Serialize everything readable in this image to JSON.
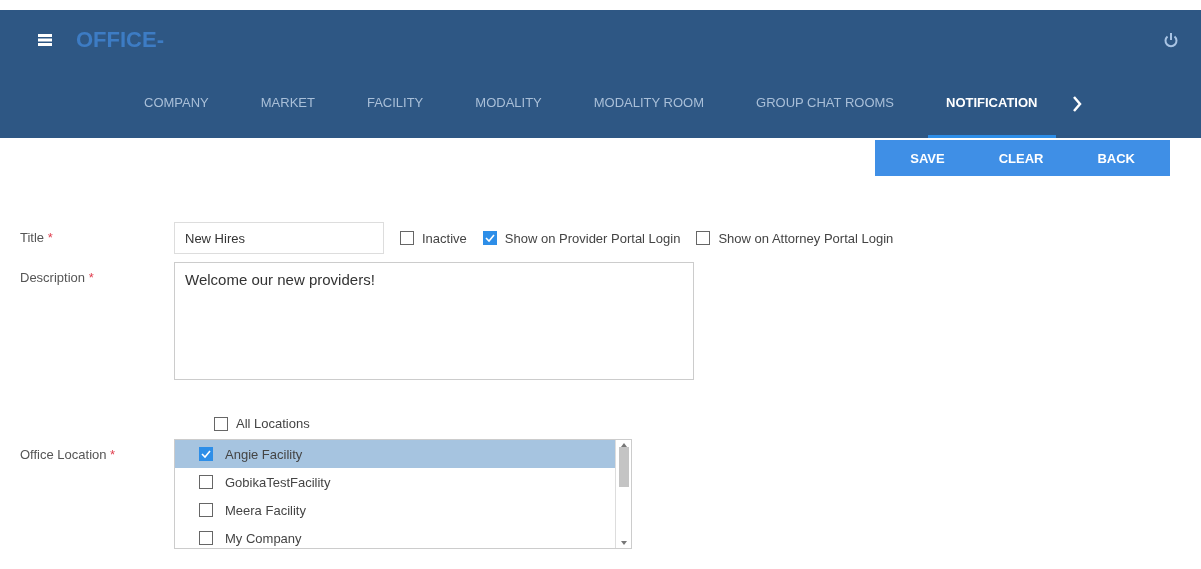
{
  "header": {
    "brand": "OFFICE-"
  },
  "tabs": [
    {
      "label": "COMPANY",
      "selected": false
    },
    {
      "label": "MARKET",
      "selected": false
    },
    {
      "label": "FACILITY",
      "selected": false
    },
    {
      "label": "MODALITY",
      "selected": false
    },
    {
      "label": "MODALITY ROOM",
      "selected": false
    },
    {
      "label": "GROUP CHAT ROOMS",
      "selected": false
    },
    {
      "label": "NOTIFICATION",
      "selected": true
    }
  ],
  "actions": [
    "SAVE",
    "CLEAR",
    "BACK"
  ],
  "form": {
    "title_label": "Title",
    "title_mark": "*",
    "description_mark": "*",
    "location_mark": "*",
    "title_value": "New Hires",
    "flags": [
      {
        "label": "Inactive",
        "checked": false
      },
      {
        "label": "Show on Provider Portal Login",
        "checked": true
      },
      {
        "label": "Show on Attorney Portal Login",
        "checked": false
      }
    ],
    "description_label": "Description",
    "description_value": "Welcome our new providers!",
    "all_locations": {
      "label": "All Locations",
      "checked": false
    },
    "location_label": "Office Location",
    "locations": [
      {
        "label": "Angie Facility",
        "checked": true,
        "selected": true
      },
      {
        "label": "GobikaTestFacility",
        "checked": false,
        "selected": false
      },
      {
        "label": "Meera Facility",
        "checked": false,
        "selected": false
      },
      {
        "label": "My Company",
        "checked": false,
        "selected": false
      }
    ]
  }
}
